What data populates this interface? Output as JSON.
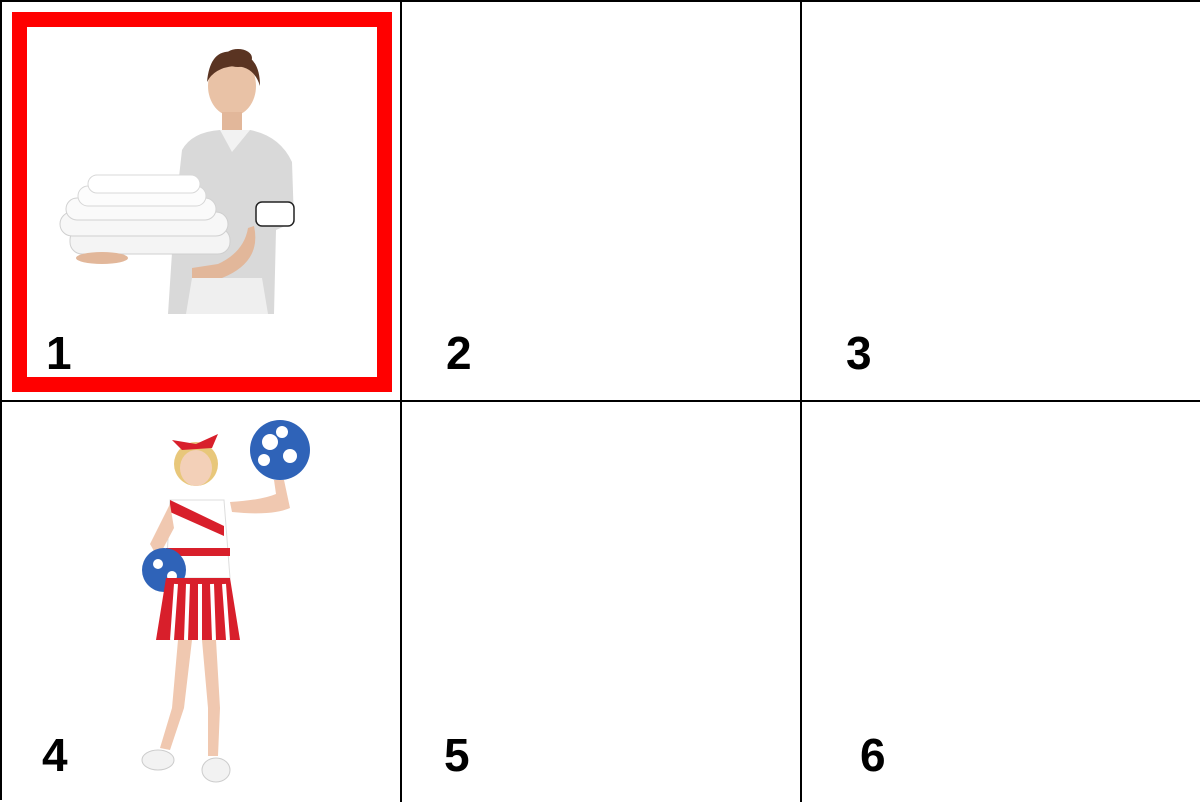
{
  "grid": {
    "cells": [
      {
        "label": "1",
        "image": "housekeeper-holding-towels",
        "selected": true
      },
      {
        "label": "2",
        "image": "",
        "selected": false
      },
      {
        "label": "3",
        "image": "",
        "selected": false
      },
      {
        "label": "4",
        "image": "cheerleader-with-pom-poms",
        "selected": false
      },
      {
        "label": "5",
        "image": "",
        "selected": false
      },
      {
        "label": "6",
        "image": "",
        "selected": false
      }
    ]
  },
  "colors": {
    "selection_border": "#ff0000",
    "grid_lines": "#000000",
    "background": "#ffffff"
  }
}
